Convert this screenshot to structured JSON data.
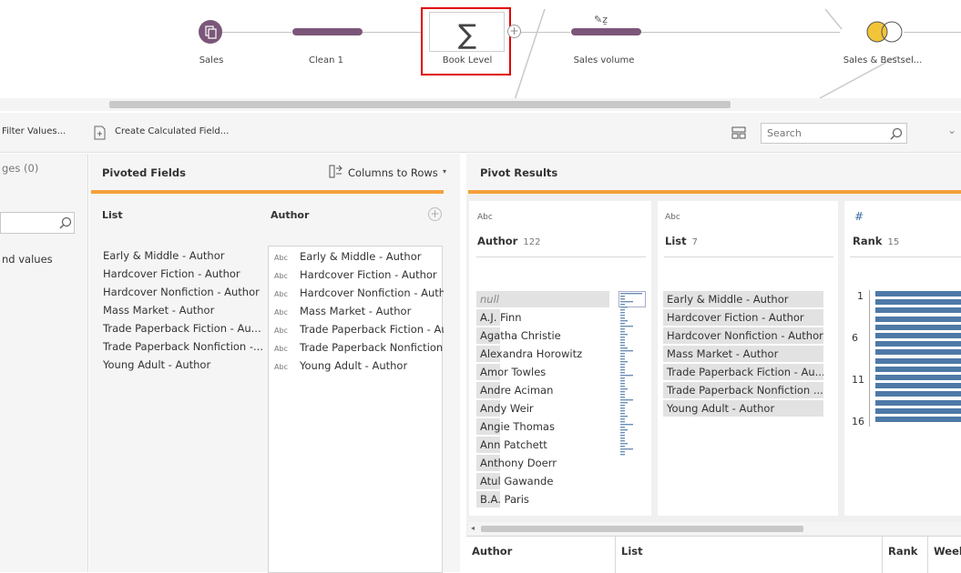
{
  "flow": {
    "nodes": [
      {
        "label": "Sales",
        "icon": "sales-input-icon"
      },
      {
        "label": "Clean 1",
        "icon": "clean-step-bar"
      },
      {
        "label": "Book Level",
        "icon": "aggregate-sigma-icon",
        "selected": true
      },
      {
        "label": "Sales volume",
        "icon": "pivot-step-bar"
      },
      {
        "label": "Sales & Bestsel...",
        "icon": "join-icon"
      }
    ],
    "colors": {
      "step": "#7b5679",
      "selection": "#e00000",
      "join_left": "#f2c438"
    }
  },
  "toolbar": {
    "filter_values": "Filter Values...",
    "create_calculated_field": "Create Calculated Field...",
    "search_placeholder": "Search"
  },
  "left_panel": {
    "changes_label": "ges (0)",
    "values_label": "nd values"
  },
  "pivoted_fields": {
    "title": "Pivoted Fields",
    "columns_to_rows": "Columns to Rows",
    "list_header": "List",
    "author_header": "Author",
    "list_items": [
      "Early & Middle - Author",
      "Hardcover Fiction - Author",
      "Hardcover Nonfiction - Author",
      "Mass Market - Author",
      "Trade Paperback Fiction - Au...",
      "Trade Paperback Nonfiction -...",
      "Young Adult - Author"
    ],
    "author_items": [
      "Early & Middle - Author",
      "Hardcover Fiction - Author",
      "Hardcover Nonfiction - Auth",
      "Mass Market - Author",
      "Trade Paperback Fiction - Au",
      "Trade Paperback Nonfiction",
      "Young Adult - Author"
    ],
    "type_label": "Abc"
  },
  "pivot_results": {
    "title": "Pivot Results",
    "author_card": {
      "type": "Abc",
      "title": "Author",
      "count": "122",
      "values": [
        "null",
        "A.J. Finn",
        "Agatha Christie",
        "Alexandra Horowitz",
        "Amor Towles",
        "Andre Aciman",
        "Andy Weir",
        "Angie Thomas",
        "Ann Patchett",
        "Anthony Doerr",
        "Atul Gawande",
        "B.A. Paris"
      ],
      "bar_fractions": [
        1.0,
        0.18,
        0.05,
        0.05,
        0.05,
        0.05,
        0.05,
        0.1,
        0.05,
        0.05,
        0.05,
        0.05
      ]
    },
    "list_card": {
      "type": "Abc",
      "title": "List",
      "count": "7",
      "values": [
        "Early & Middle - Author",
        "Hardcover Fiction - Author",
        "Hardcover Nonfiction - Author",
        "Mass Market - Author",
        "Trade Paperback Fiction - Au...",
        "Trade Paperback Nonfiction ...",
        "Young Adult - Author"
      ]
    },
    "rank_card": {
      "type": "#",
      "title": "Rank",
      "count": "15",
      "ticks": [
        "1",
        "6",
        "11",
        "16"
      ]
    },
    "grid_headers": [
      "Author",
      "List",
      "Rank",
      "Week"
    ]
  }
}
